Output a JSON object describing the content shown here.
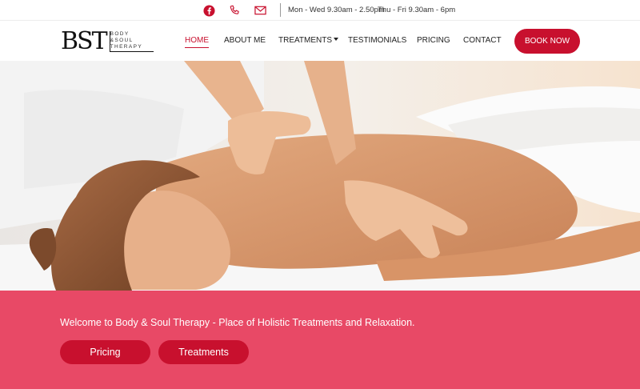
{
  "topbar": {
    "icons": [
      "facebook-icon",
      "phone-icon",
      "mail-icon"
    ],
    "hours_weekdays": "Mon - Wed 9.30am - 2.50pm",
    "hours_thu_fri": "Thu - Fri 9.30am - 6pm"
  },
  "logo": {
    "mark": "BST",
    "line1": "BODY",
    "line2": "&SOUL",
    "line3": "THERAPY"
  },
  "nav": {
    "items": [
      {
        "label": "HOME",
        "active": true
      },
      {
        "label": "ABOUT ME"
      },
      {
        "label": "TREATMENTS",
        "has_dropdown": true
      },
      {
        "label": "TESTIMONIALS"
      },
      {
        "label": "PRICING"
      },
      {
        "label": "CONTACT"
      }
    ],
    "book_label": "BOOK NOW"
  },
  "hero": {
    "welcome": "Welcome to Body & Soul Therapy - Place of Holistic Treatments and Relaxation.",
    "button_pricing": "Pricing",
    "button_treatments": "Treatments"
  },
  "colors": {
    "accent": "#c8102e",
    "band": "#e84966"
  }
}
